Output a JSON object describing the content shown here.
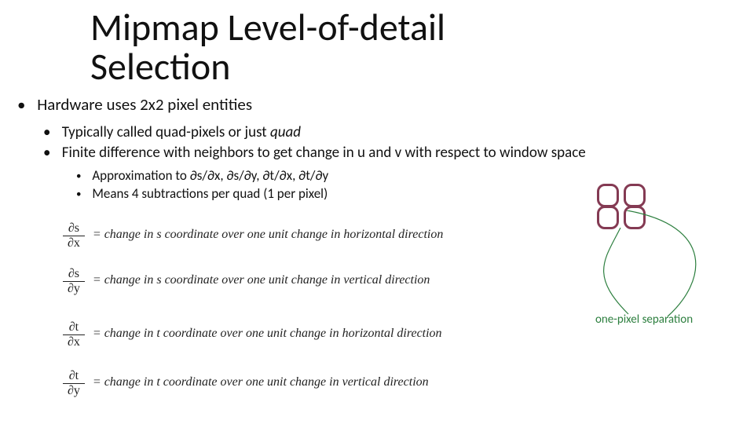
{
  "title_line1": "Mipmap Level-of-detail",
  "title_line2": "Selection",
  "b1": "Hardware uses 2x2 pixel entities",
  "b2_prefix": "Typically called quad-pixels or just ",
  "b2_italic": "quad",
  "b3": "Finite difference with neighbors to get change in u and v with respect to window space",
  "b4": "Approximation to ∂s/∂x, ∂s/∂y, ∂t/∂x, ∂t/∂y",
  "b5": "Means 4 subtractions per quad (1 per pixel)",
  "eq1": {
    "num": "∂s",
    "den": "∂x",
    "rest": "= change in s coordinate over one unit change in horizontal direction"
  },
  "eq2": {
    "num": "∂s",
    "den": "∂y",
    "rest": "= change in s coordinate over one unit change in vertical direction"
  },
  "eq3": {
    "num": "∂t",
    "den": "∂x",
    "rest": "= change in t coordinate over one unit change in horizontal direction"
  },
  "eq4": {
    "num": "∂t",
    "den": "∂y",
    "rest": "= change in t coordinate over one unit change in vertical direction"
  },
  "sep_label": "one-pixel separation"
}
